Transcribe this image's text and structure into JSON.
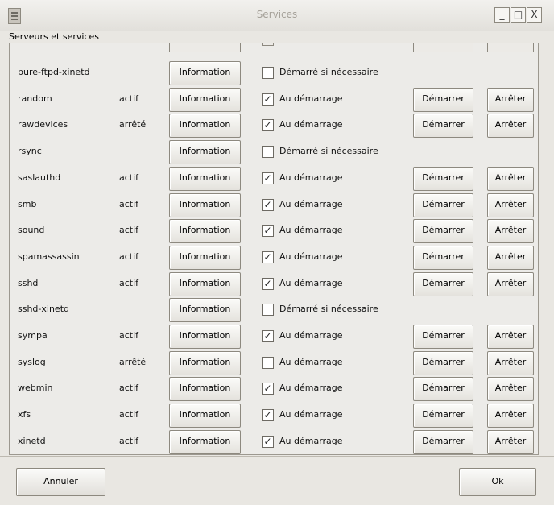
{
  "window": {
    "title": "Services",
    "minimize": "_",
    "maximize": "□",
    "close": "X"
  },
  "group_label": "Serveurs et services",
  "services": [
    {
      "name": "pure-ftpd-xinetd",
      "status": "",
      "info": "Information",
      "checked": false,
      "boot_label": "Démarré si nécessaire",
      "start": "",
      "stop": ""
    },
    {
      "name": "random",
      "status": "actif",
      "info": "Information",
      "checked": true,
      "boot_label": "Au démarrage",
      "start": "Démarrer",
      "stop": "Arrêter"
    },
    {
      "name": "rawdevices",
      "status": "arrêté",
      "info": "Information",
      "checked": true,
      "boot_label": "Au démarrage",
      "start": "Démarrer",
      "stop": "Arrêter"
    },
    {
      "name": "rsync",
      "status": "",
      "info": "Information",
      "checked": false,
      "boot_label": "Démarré si nécessaire",
      "start": "",
      "stop": ""
    },
    {
      "name": "saslauthd",
      "status": "actif",
      "info": "Information",
      "checked": true,
      "boot_label": "Au démarrage",
      "start": "Démarrer",
      "stop": "Arrêter"
    },
    {
      "name": "smb",
      "status": "actif",
      "info": "Information",
      "checked": true,
      "boot_label": "Au démarrage",
      "start": "Démarrer",
      "stop": "Arrêter"
    },
    {
      "name": "sound",
      "status": "actif",
      "info": "Information",
      "checked": true,
      "boot_label": "Au démarrage",
      "start": "Démarrer",
      "stop": "Arrêter"
    },
    {
      "name": "spamassassin",
      "status": "actif",
      "info": "Information",
      "checked": true,
      "boot_label": "Au démarrage",
      "start": "Démarrer",
      "stop": "Arrêter"
    },
    {
      "name": "sshd",
      "status": "actif",
      "info": "Information",
      "checked": true,
      "boot_label": "Au démarrage",
      "start": "Démarrer",
      "stop": "Arrêter"
    },
    {
      "name": "sshd-xinetd",
      "status": "",
      "info": "Information",
      "checked": false,
      "boot_label": "Démarré si nécessaire",
      "start": "",
      "stop": ""
    },
    {
      "name": "sympa",
      "status": "actif",
      "info": "Information",
      "checked": true,
      "boot_label": "Au démarrage",
      "start": "Démarrer",
      "stop": "Arrêter"
    },
    {
      "name": "syslog",
      "status": "arrêté",
      "info": "Information",
      "checked": false,
      "boot_label": "Au démarrage",
      "start": "Démarrer",
      "stop": "Arrêter"
    },
    {
      "name": "webmin",
      "status": "actif",
      "info": "Information",
      "checked": true,
      "boot_label": "Au démarrage",
      "start": "Démarrer",
      "stop": "Arrêter"
    },
    {
      "name": "xfs",
      "status": "actif",
      "info": "Information",
      "checked": true,
      "boot_label": "Au démarrage",
      "start": "Démarrer",
      "stop": "Arrêter"
    },
    {
      "name": "xinetd",
      "status": "actif",
      "info": "Information",
      "checked": true,
      "boot_label": "Au démarrage",
      "start": "Démarrer",
      "stop": "Arrêter"
    }
  ],
  "footer": {
    "cancel": "Annuler",
    "ok": "Ok"
  },
  "icons": {
    "check": "✓",
    "scroll_up": "▲",
    "scroll_down": "▼"
  }
}
